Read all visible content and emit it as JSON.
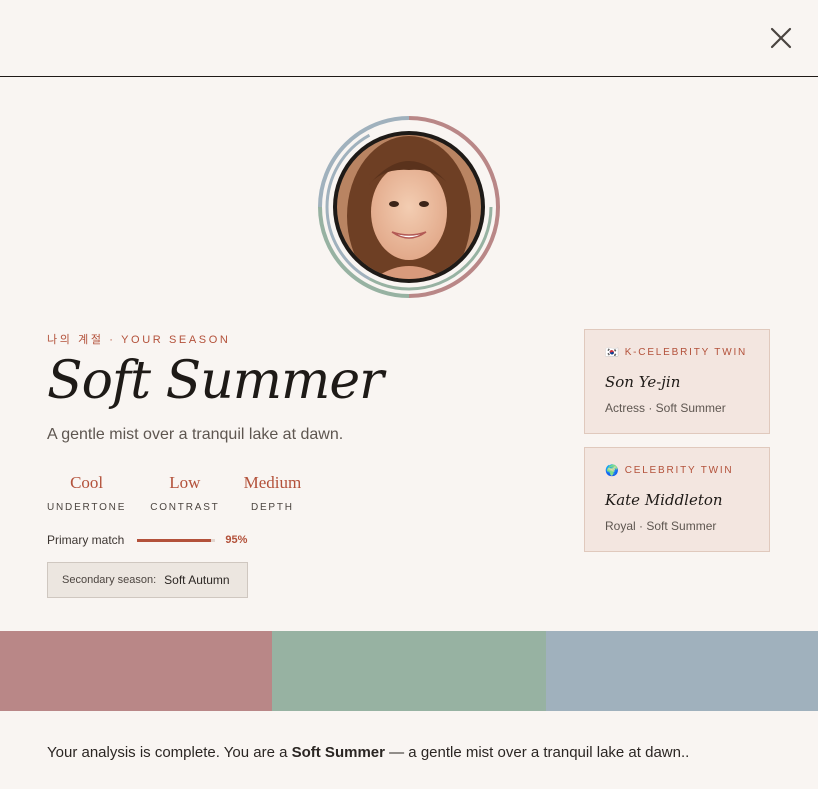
{
  "eyebrow": "나의 계절 · YOUR SEASON",
  "season": {
    "name": "Soft Summer",
    "tagline": "A gentle mist over a tranquil lake at dawn."
  },
  "stats": [
    {
      "value": "Cool",
      "label": "UNDERTONE"
    },
    {
      "value": "Low",
      "label": "CONTRAST"
    },
    {
      "value": "Medium",
      "label": "DEPTH"
    }
  ],
  "match": {
    "label": "Primary match",
    "percent_text": "95%",
    "percent": 95
  },
  "secondary": {
    "label": "Secondary season:",
    "value": "Soft Autumn"
  },
  "twins": [
    {
      "flag": "🇰🇷",
      "heading": "K-CELEBRITY TWIN",
      "name": "Son Ye-jin",
      "role": "Actress · Soft Summer"
    },
    {
      "flag": "🌍",
      "heading": "CELEBRITY TWIN",
      "name": "Kate Middleton",
      "role": "Royal · Soft Summer"
    }
  ],
  "palette": [
    "#b98787",
    "#97b2a2",
    "#a0b1bd"
  ],
  "summary": {
    "before": "Your analysis is complete. You are a ",
    "season": "Soft Summer",
    "after": " — a gentle mist over a tranquil lake at dawn.."
  },
  "colors": {
    "accent": "#b3513a",
    "ink": "#1e1a17",
    "background": "#f9f5f2"
  },
  "icons": {
    "close": "close-icon",
    "avatar": "user-photo"
  }
}
